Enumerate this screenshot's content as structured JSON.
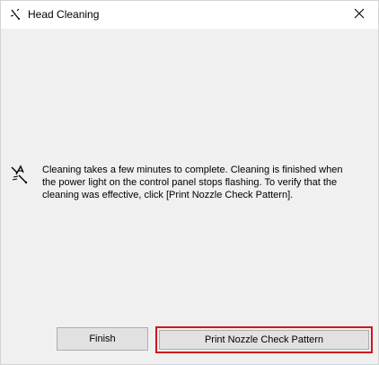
{
  "window": {
    "title": "Head Cleaning",
    "title_icon": "printer-head-icon",
    "close_icon": "close-icon"
  },
  "message": {
    "icon": "head-cleaning-icon",
    "text": "Cleaning takes a few minutes to complete. Cleaning is finished when the power light on the control panel stops flashing. To verify that the cleaning was effective, click [Print Nozzle Check Pattern]."
  },
  "buttons": {
    "finish_label": "Finish",
    "print_label": "Print Nozzle Check Pattern"
  },
  "colors": {
    "highlight_border": "#d0161e",
    "dialog_background": "#f0f0f0",
    "button_background": "#e1e1e1"
  }
}
